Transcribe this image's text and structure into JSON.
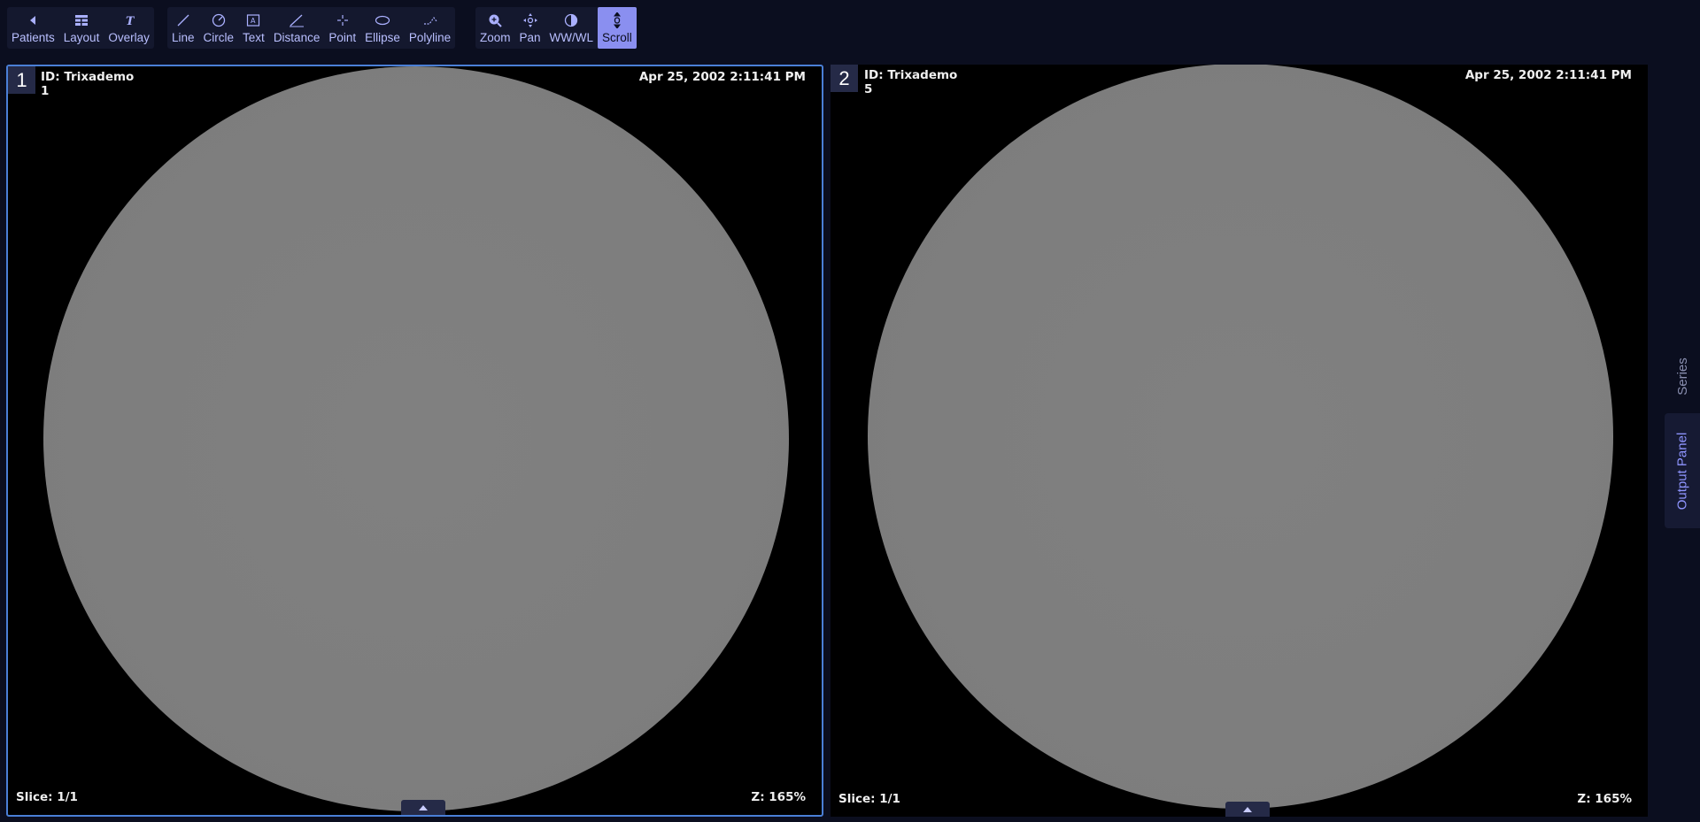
{
  "toolbar": {
    "groups": [
      {
        "tools": [
          {
            "label": "Patients",
            "icon": "chevron-left-icon"
          },
          {
            "label": "Layout",
            "icon": "layout-grid-icon"
          },
          {
            "label": "Overlay",
            "icon": "overlay-t-icon"
          }
        ]
      },
      {
        "tools": [
          {
            "label": "Line",
            "icon": "line-icon"
          },
          {
            "label": "Circle",
            "icon": "circle-icon"
          },
          {
            "label": "Text",
            "icon": "text-icon"
          },
          {
            "label": "Distance",
            "icon": "distance-icon"
          },
          {
            "label": "Point",
            "icon": "point-icon"
          },
          {
            "label": "Ellipse",
            "icon": "ellipse-icon"
          },
          {
            "label": "Polyline",
            "icon": "polyline-icon"
          }
        ]
      },
      {
        "tools": [
          {
            "label": "Zoom",
            "icon": "zoom-icon"
          },
          {
            "label": "Pan",
            "icon": "pan-icon"
          },
          {
            "label": "WW/WL",
            "icon": "contrast-icon"
          },
          {
            "label": "Scroll",
            "icon": "scroll-icon",
            "active": true
          }
        ]
      }
    ]
  },
  "viewports": [
    {
      "index": "1",
      "patient_id": "ID: Trixademo",
      "sub": "1",
      "date": "Apr 25, 2002 2:11:41 PM",
      "slice": "Slice: 1/1",
      "zoom": "Z: 165%",
      "selected": true
    },
    {
      "index": "2",
      "patient_id": "ID: Trixademo",
      "sub": "5",
      "date": "Apr 25, 2002 2:11:41 PM",
      "slice": "Slice: 1/1",
      "zoom": "Z: 165%",
      "selected": false
    }
  ],
  "side_panel": {
    "series_label": "Series",
    "output_label": "Output Panel"
  },
  "colors": {
    "background": "#0b0e1f",
    "accent": "#8a8ff0",
    "selected_border": "#4a7fd6",
    "image_gray": "#808080"
  }
}
